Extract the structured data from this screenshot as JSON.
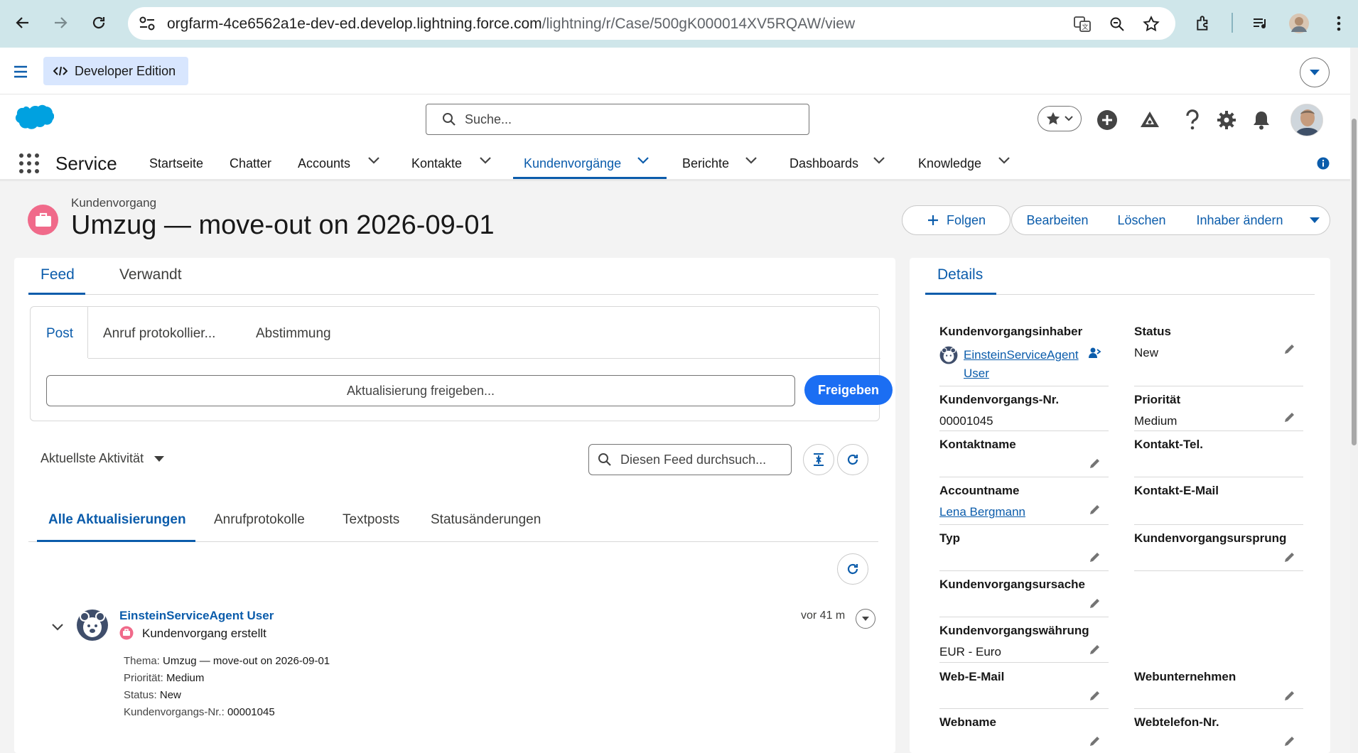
{
  "browser": {
    "url_host": "orgfarm-4ce6562a1e-dev-ed.develop.lightning.force.com",
    "url_path": "/lightning/r/Case/500gK000014XV5RQAW/view"
  },
  "sf": {
    "org_badge": "Developer Edition",
    "search_placeholder": "Suche...",
    "app_name": "Service",
    "nav": [
      {
        "label": "Startseite"
      },
      {
        "label": "Chatter"
      },
      {
        "label": "Accounts"
      },
      {
        "label": "Kontakte"
      },
      {
        "label": "Kundenvorgänge"
      },
      {
        "label": "Berichte"
      },
      {
        "label": "Dashboards"
      },
      {
        "label": "Knowledge"
      }
    ],
    "colors": {
      "brand": "#0b5cab",
      "case_icon": "#f06a8a",
      "primary_button": "#1b6ef3"
    }
  },
  "record": {
    "object_label": "Kundenvorgang",
    "title": "Umzug — move-out on 2026-09-01",
    "actions": {
      "follow": "Folgen",
      "edit": "Bearbeiten",
      "delete": "Löschen",
      "change_owner": "Inhaber ändern"
    }
  },
  "left": {
    "tabs": [
      "Feed",
      "Verwandt"
    ],
    "composer": {
      "tabs": [
        "Post",
        "Anruf protokollier...",
        "Abstimmung"
      ],
      "placeholder": "Aktualisierung freigeben...",
      "share_label": "Freigeben"
    },
    "sort_label": "Aktuellste Aktivität",
    "feed_search_placeholder": "Diesen Feed durchsuch...",
    "feed_tabs": [
      "Alle Aktualisierungen",
      "Anrufprotokolle",
      "Textposts",
      "Statusänderungen"
    ],
    "post": {
      "author": "EinsteinServiceAgent User",
      "action": "Kundenvorgang erstellt",
      "time": "vor 41 m",
      "lines": [
        {
          "label": "Thema:",
          "value": "Umzug — move-out on 2026-09-01"
        },
        {
          "label": "Priorität:",
          "value": "Medium"
        },
        {
          "label": "Status:",
          "value": "New"
        },
        {
          "label": "Kundenvorgangs-Nr.:",
          "value": "00001045"
        }
      ]
    }
  },
  "details": {
    "tab": "Details",
    "owner_label": "Kundenvorgangsinhaber",
    "owner_name_line1": "EinsteinServiceAgent",
    "owner_name_line2": "User",
    "status_label": "Status",
    "status_value": "New",
    "case_number_label": "Kundenvorgangs-Nr.",
    "case_number_value": "00001045",
    "priority_label": "Priorität",
    "priority_value": "Medium",
    "contact_name_label": "Kontaktname",
    "contact_phone_label": "Kontakt-Tel.",
    "account_label": "Accountname",
    "account_value": "Lena Bergmann",
    "contact_email_label": "Kontakt-E-Mail",
    "type_label": "Typ",
    "origin_label": "Kundenvorgangsursprung",
    "reason_label": "Kundenvorgangsursache",
    "currency_label": "Kundenvorgangswährung",
    "currency_value": "EUR - Euro",
    "web_email_label": "Web-E-Mail",
    "web_company_label": "Webunternehmen",
    "web_name_label": "Webname",
    "web_phone_label": "Webtelefon-Nr."
  }
}
